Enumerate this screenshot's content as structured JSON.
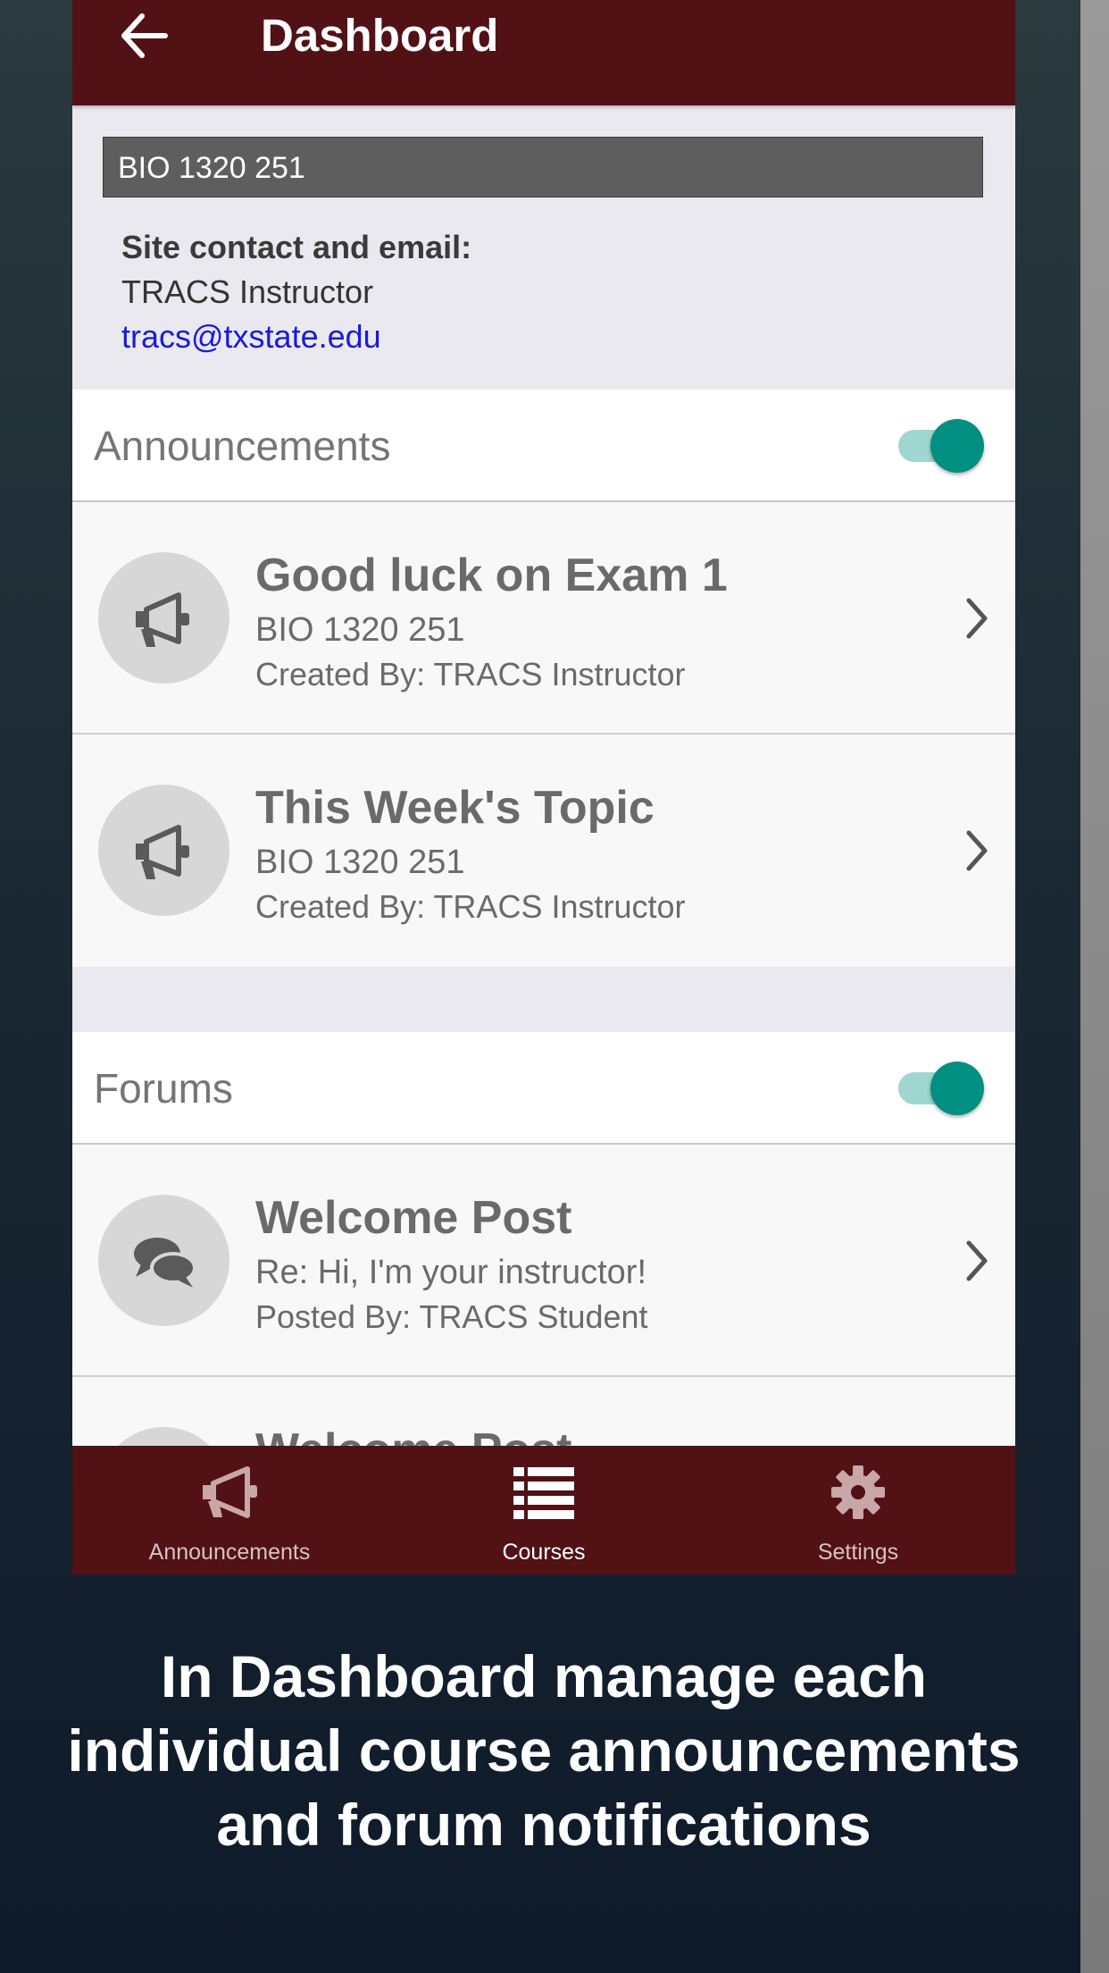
{
  "header": {
    "back_icon": "arrow-left-icon",
    "title": "Dashboard"
  },
  "course": {
    "code": "BIO 1320 251"
  },
  "contact": {
    "label": "Site contact and email:",
    "name": "TRACS Instructor",
    "email": "tracs@txstate.edu"
  },
  "announcements": {
    "section_title": "Announcements",
    "toggle_on": true,
    "items": [
      {
        "icon": "megaphone-icon",
        "title": "Good luck on Exam 1",
        "course": "BIO 1320 251",
        "created_by": "Created By: TRACS Instructor"
      },
      {
        "icon": "megaphone-icon",
        "title": "This Week's Topic",
        "course": "BIO 1320 251",
        "created_by": "Created By: TRACS Instructor"
      }
    ]
  },
  "forums": {
    "section_title": "Forums",
    "toggle_on": true,
    "items": [
      {
        "icon": "chat-bubbles-icon",
        "title": "Welcome Post",
        "subject": "Re: Hi, I'm your instructor!",
        "posted_by": "Posted By: TRACS Student"
      },
      {
        "icon": "chat-bubbles-icon",
        "title": "Welcome Post"
      }
    ]
  },
  "bottom_nav": {
    "items": [
      {
        "label": "Announcements",
        "icon": "megaphone-icon",
        "active": false
      },
      {
        "label": "Courses",
        "icon": "list-icon",
        "active": true
      },
      {
        "label": "Settings",
        "icon": "gear-icon",
        "active": false
      }
    ]
  },
  "caption": {
    "line1": "In Dashboard manage each",
    "line2": "individual course announcements",
    "line3": "and forum notifications"
  },
  "colors": {
    "brand_maroon": "#521115",
    "toggle_accent": "#008f80",
    "link_blue": "#1a1adc"
  }
}
